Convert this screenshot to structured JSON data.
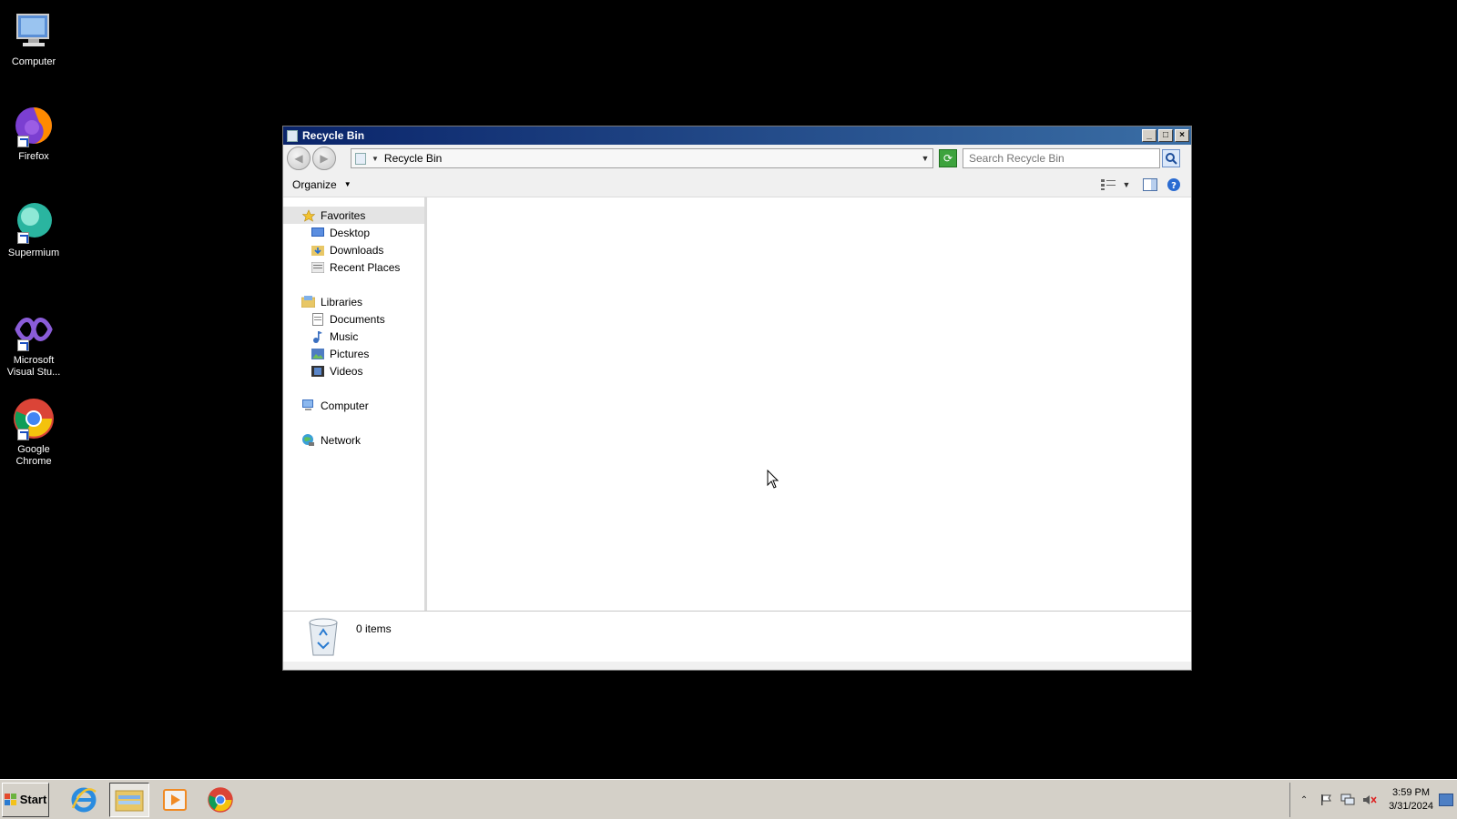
{
  "desktop": {
    "icons": [
      {
        "label": "Computer",
        "icon": "computer-icon"
      },
      {
        "label": "Firefox",
        "icon": "firefox-icon"
      },
      {
        "label": "Supermium",
        "icon": "supermium-icon"
      },
      {
        "label_line1": "Microsoft",
        "label_line2": "Visual Stu...",
        "icon": "visual-studio-icon"
      },
      {
        "label_line1": "Google",
        "label_line2": "Chrome",
        "icon": "chrome-icon"
      }
    ]
  },
  "window": {
    "title": "Recycle Bin",
    "address": "Recycle Bin",
    "search_placeholder": "Search Recycle Bin",
    "toolbar": {
      "organize": "Organize"
    },
    "navpane": {
      "favorites": "Favorites",
      "favorites_items": [
        "Desktop",
        "Downloads",
        "Recent Places"
      ],
      "libraries": "Libraries",
      "libraries_items": [
        "Documents",
        "Music",
        "Pictures",
        "Videos"
      ],
      "computer": "Computer",
      "network": "Network"
    },
    "details": {
      "count": "0 items"
    }
  },
  "taskbar": {
    "start": "Start",
    "apps": [
      "internet-explorer-icon",
      "file-explorer-icon",
      "media-player-icon",
      "chrome-icon"
    ],
    "time": "3:59 PM",
    "date": "3/31/2024"
  },
  "colors": {
    "titlebar_start": "#0a246a",
    "titlebar_end": "#3a6ea5",
    "desktop": "#000000"
  }
}
